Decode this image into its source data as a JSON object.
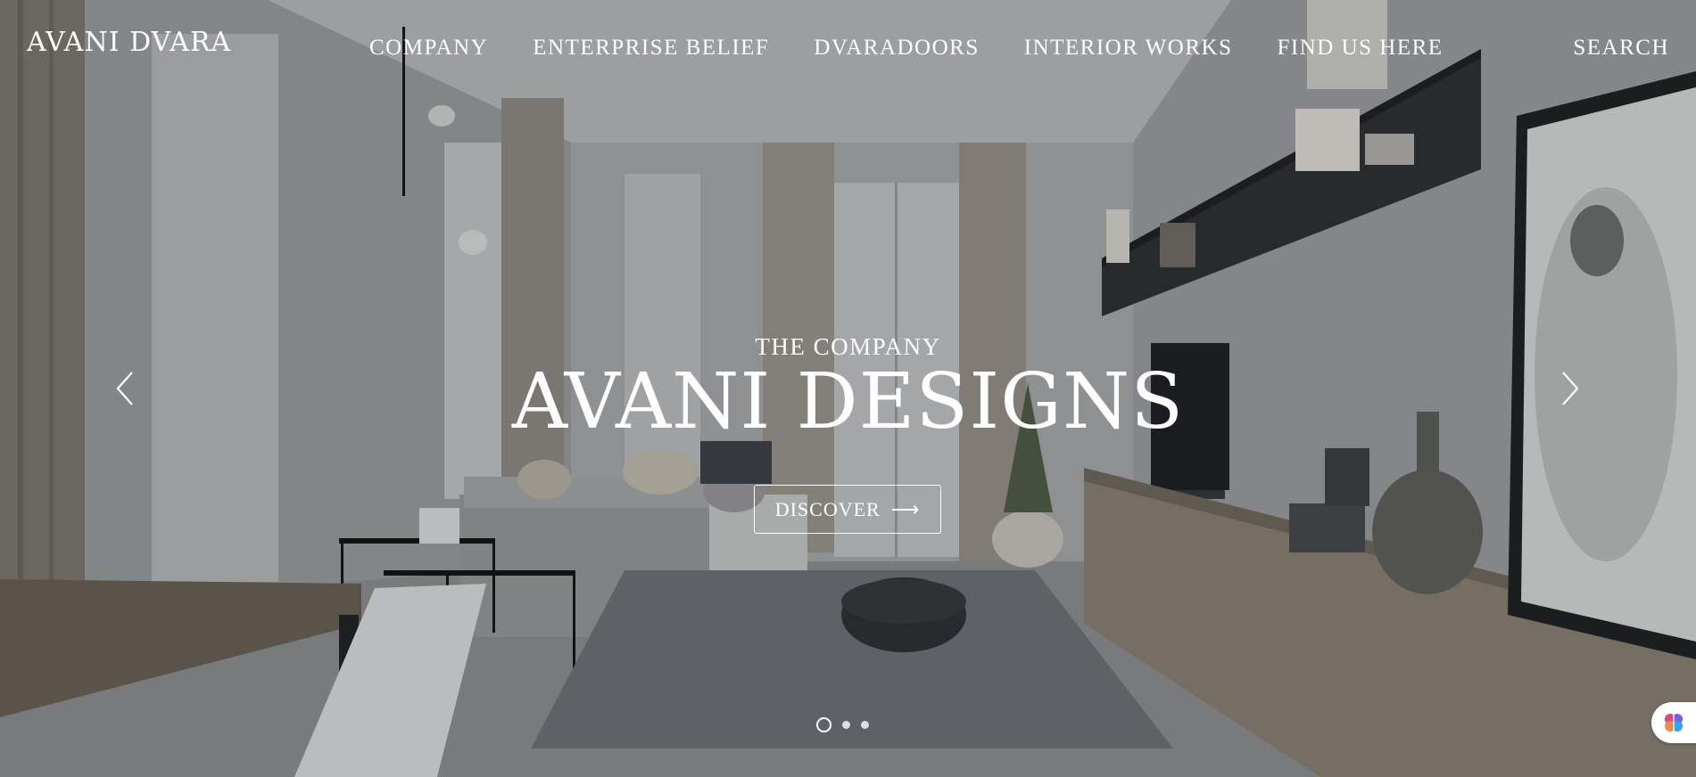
{
  "brand": {
    "logo_text": "AVANI DVARA"
  },
  "nav": {
    "items": [
      {
        "label": "COMPANY"
      },
      {
        "label": "ENTERPRISE BELIEF"
      },
      {
        "label": "DVARADOORS"
      },
      {
        "label": "INTERIOR WORKS"
      },
      {
        "label": "FIND US HERE"
      }
    ],
    "search_label": "SEARCH"
  },
  "hero": {
    "kicker": "THE COMPANY",
    "headline": "AVANI DESIGNS",
    "cta_label": "DISCOVER",
    "cta_arrow": "⟶"
  },
  "slider": {
    "slide_count": 3,
    "active_index": 0,
    "prev_icon": "chevron-left-icon",
    "next_icon": "chevron-right-icon"
  },
  "widget": {
    "icon": "brain-icon"
  },
  "colors": {
    "text": "#ffffff",
    "overlay": "rgba(30,32,36,0.18)",
    "widget_accent": "#e0457b"
  }
}
